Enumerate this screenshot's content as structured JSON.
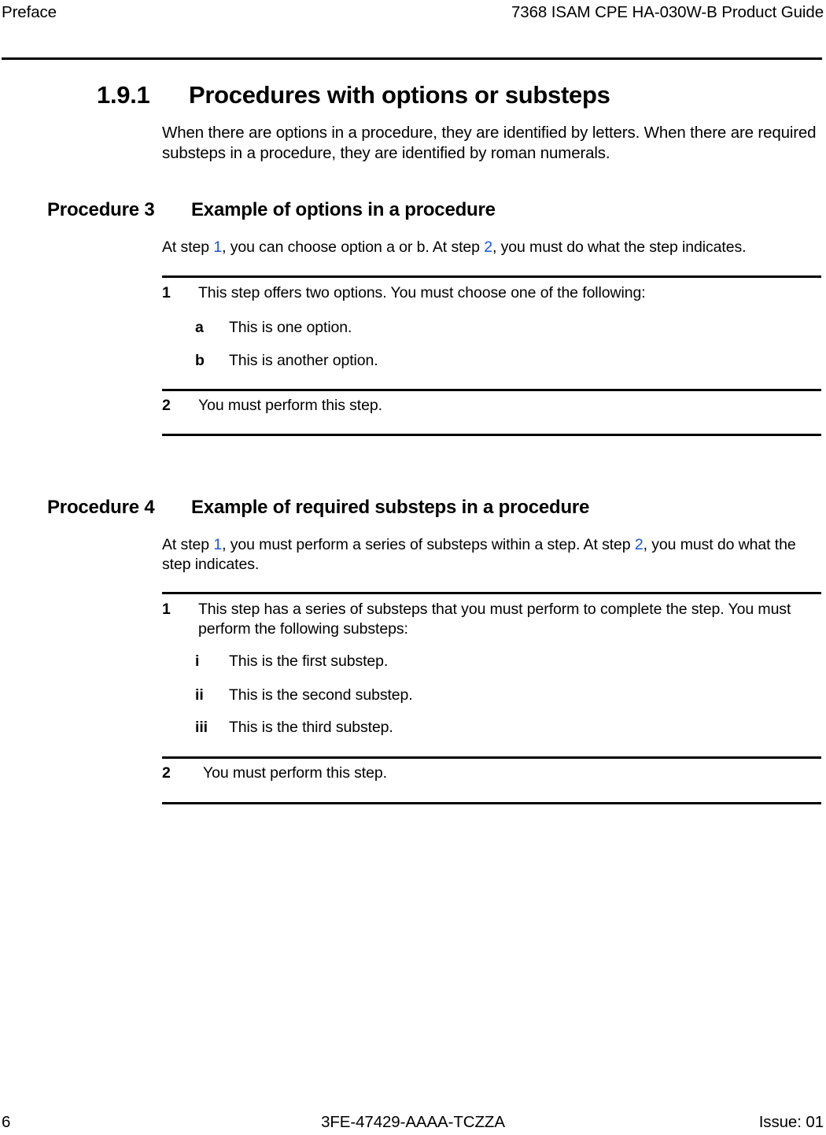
{
  "header": {
    "left": "Preface",
    "right": "7368 ISAM CPE HA-030W-B Product Guide"
  },
  "section": {
    "number": "1.9.1",
    "title": "Procedures with options or substeps",
    "intro": "When there are options in a procedure, they are identified by letters. When there are required substeps in a procedure, they are identified by roman numerals."
  },
  "procedures": [
    {
      "label": "Procedure 3",
      "title": "Example of options in a procedure",
      "intro_part1": "At step ",
      "intro_xref1": "1",
      "intro_part2": ", you can choose option a or b. At step ",
      "intro_xref2": "2",
      "intro_part3": ", you must do what the step indicates.",
      "steps": [
        {
          "marker": "1",
          "text": "This step offers two options. You must choose one of the following:"
        },
        {
          "marker": "2",
          "text": "You must perform this step."
        }
      ],
      "substeps": [
        {
          "marker": "a",
          "text": "This is one option."
        },
        {
          "marker": "b",
          "text": "This is another option."
        }
      ]
    },
    {
      "label": "Procedure 4",
      "title": "Example of required substeps in a procedure",
      "intro_part1": "At step ",
      "intro_xref1": "1",
      "intro_part2": ", you must perform a series of substeps within a step. At step ",
      "intro_xref2": "2",
      "intro_part3": ", you must do what the step indicates.",
      "steps": [
        {
          "marker": "1",
          "text": "This step has a series of substeps that you must perform to complete the step. You must perform the following substeps:"
        },
        {
          "marker": "2",
          "text": "You must perform this step."
        }
      ],
      "substeps": [
        {
          "marker": "i",
          "text": "This is the first substep."
        },
        {
          "marker": "ii",
          "text": "This is the second substep."
        },
        {
          "marker": "iii",
          "text": "This is the third substep."
        }
      ]
    }
  ],
  "footer": {
    "page_number": "6",
    "document_code": "3FE-47429-AAAA-TCZZA",
    "issue": "Issue: 01"
  },
  "colors": {
    "xref_blue": "#1a55dd",
    "text": "#000000",
    "background": "#ffffff"
  }
}
